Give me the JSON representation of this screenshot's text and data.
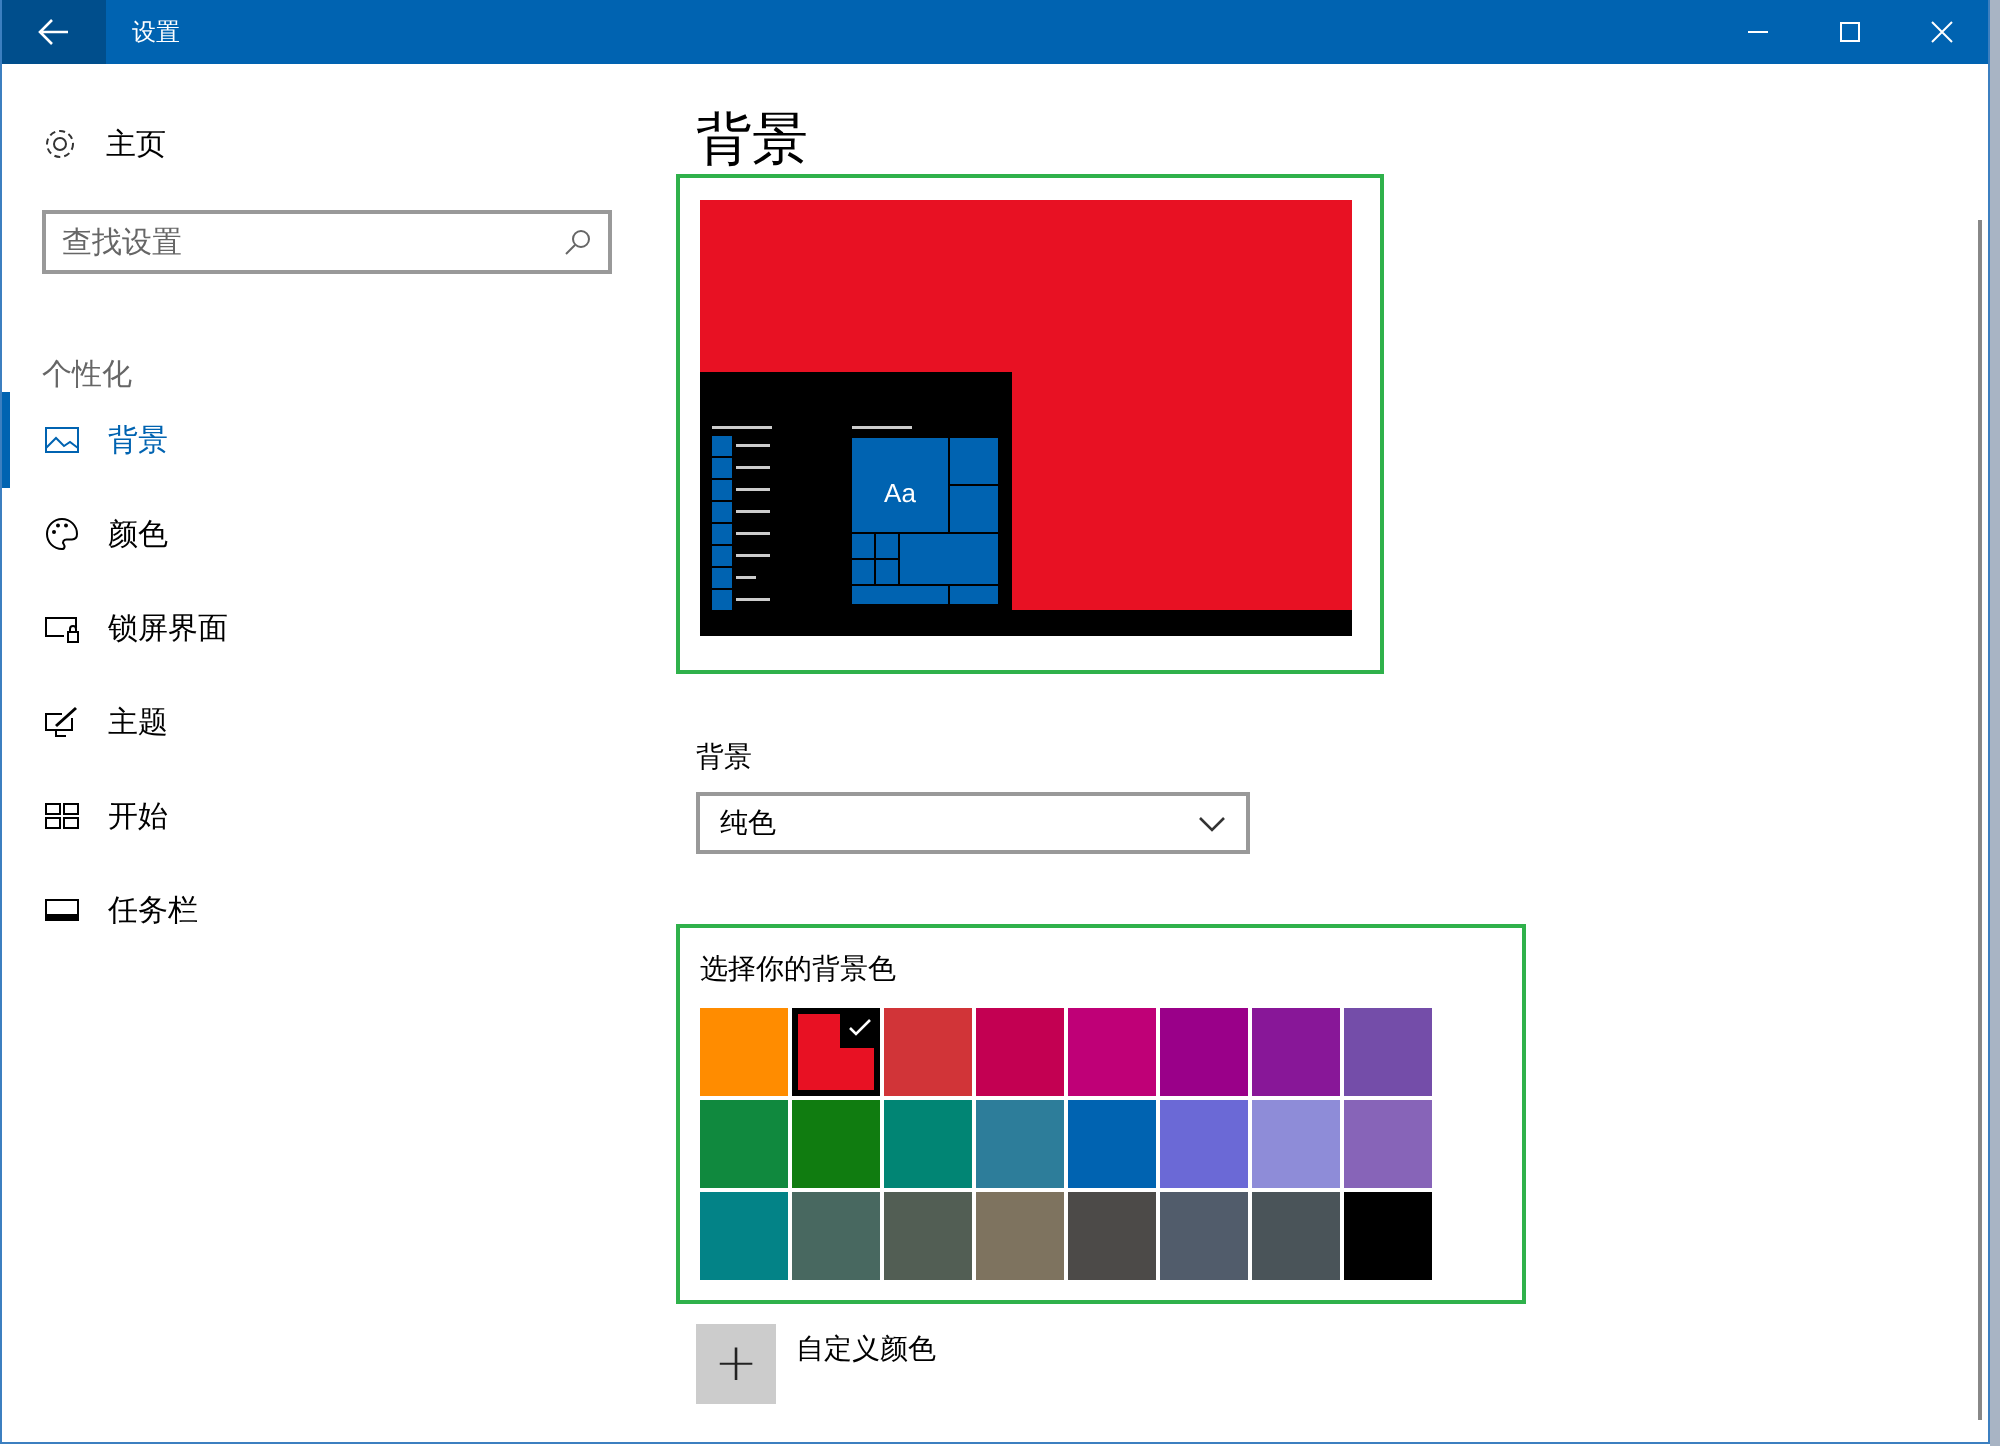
{
  "window": {
    "title": "设置"
  },
  "sidebar": {
    "home": "主页",
    "search": {
      "placeholder": "查找设置"
    },
    "section": "个性化",
    "items": [
      {
        "label": "背景",
        "selected": true
      },
      {
        "label": "颜色",
        "selected": false
      },
      {
        "label": "锁屏界面",
        "selected": false
      },
      {
        "label": "主题",
        "selected": false
      },
      {
        "label": "开始",
        "selected": false
      },
      {
        "label": "任务栏",
        "selected": false
      }
    ]
  },
  "page": {
    "title": "背景",
    "preview": {
      "tile_text": "Aa",
      "color": "#e81123"
    },
    "background": {
      "label": "背景",
      "value": "纯色"
    },
    "colors": {
      "label": "选择你的背景色",
      "swatches": [
        {
          "color": "#ff8c00",
          "selected": false
        },
        {
          "color": "#e81123",
          "selected": true
        },
        {
          "color": "#d13438",
          "selected": false
        },
        {
          "color": "#c30052",
          "selected": false
        },
        {
          "color": "#bf0077",
          "selected": false
        },
        {
          "color": "#9a0089",
          "selected": false
        },
        {
          "color": "#881798",
          "selected": false
        },
        {
          "color": "#744da9",
          "selected": false
        },
        {
          "color": "#10893e",
          "selected": false
        },
        {
          "color": "#107c10",
          "selected": false
        },
        {
          "color": "#018574",
          "selected": false
        },
        {
          "color": "#2d7d9a",
          "selected": false
        },
        {
          "color": "#0063b1",
          "selected": false
        },
        {
          "color": "#6b69d6",
          "selected": false
        },
        {
          "color": "#8e8cd8",
          "selected": false
        },
        {
          "color": "#8764b8",
          "selected": false
        },
        {
          "color": "#038387",
          "selected": false
        },
        {
          "color": "#486860",
          "selected": false
        },
        {
          "color": "#525e54",
          "selected": false
        },
        {
          "color": "#7e735f",
          "selected": false
        },
        {
          "color": "#4c4a48",
          "selected": false
        },
        {
          "color": "#515c6b",
          "selected": false
        },
        {
          "color": "#4a5459",
          "selected": false
        },
        {
          "color": "#000000",
          "selected": false
        }
      ]
    },
    "custom": {
      "icon": "+",
      "label": "自定义颜色"
    }
  }
}
